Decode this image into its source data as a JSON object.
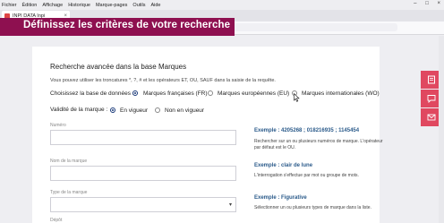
{
  "browser": {
    "menu": [
      "Fichier",
      "Édition",
      "Affichage",
      "Historique",
      "Marque-pages",
      "Outils",
      "Aide"
    ],
    "tab_title": "INPI DATA Inpi",
    "tab_close": "×",
    "new_tab": "+",
    "window_controls": [
      "–",
      "□",
      "×"
    ]
  },
  "banner": {
    "text": "Définissez les critères de votre recherche",
    "color": "#8e1050"
  },
  "form": {
    "title": "Recherche avancée dans la base Marques",
    "intro": "Vous pouvez utiliser les troncatures *, ?, # et les opérateurs ET, OU, SAUF dans la saisie de la requête.",
    "base_label": "Choisissez la base de données :",
    "base_options": [
      {
        "label": "Marques françaises (FR)",
        "selected": true
      },
      {
        "label": "Marques européennes (EU)",
        "selected": false
      },
      {
        "label": "Marques internationales (WO)",
        "selected": false
      }
    ],
    "validity_label": "Validité de la marque :",
    "validity_options": [
      {
        "label": "En vigueur",
        "selected": true
      },
      {
        "label": "Non en vigueur",
        "selected": false
      }
    ],
    "fields": [
      {
        "label": "Numéro",
        "example_title": "Exemple : 4205268 ; 018216935 ; 1145454",
        "example_desc": "Rechercher sur un ou plusieurs numéros de marque. L'opérateur par défaut est le OU."
      },
      {
        "label": "Nom de la marque",
        "example_title": "Exemple : clair de lune",
        "example_desc": "L'interrogation s'effectue par mot ou groupe de mots."
      },
      {
        "label": "Type de la marque",
        "example_title": "Exemple : Figurative",
        "example_desc": "Sélectionner un ou plusieurs types de marque dans la liste."
      }
    ],
    "bottom_label": "Dépôt"
  },
  "side_buttons": [
    "register-icon",
    "chat-icon",
    "mail-icon"
  ],
  "colors": {
    "accent": "#e04860",
    "link": "#2a5a8a",
    "banner": "#8e1050"
  }
}
